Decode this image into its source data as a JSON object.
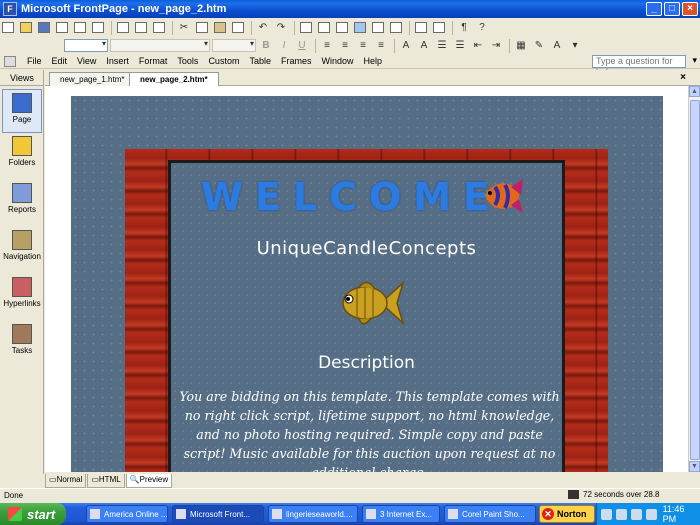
{
  "window": {
    "title": "Microsoft FrontPage - new_page_2.htm",
    "controls": {
      "minimize": "_",
      "maximize": "□",
      "close": "×"
    }
  },
  "menubar": {
    "items": [
      "File",
      "Edit",
      "View",
      "Insert",
      "Format",
      "Tools",
      "Custom",
      "Table",
      "Frames",
      "Window",
      "Help"
    ],
    "help_placeholder": "Type a question for help"
  },
  "views_panel": {
    "title": "Views",
    "items": [
      {
        "label": "Page",
        "icon": "page-view-icon",
        "active": true
      },
      {
        "label": "Folders",
        "icon": "folders-view-icon"
      },
      {
        "label": "Reports",
        "icon": "reports-view-icon"
      },
      {
        "label": "Navigation",
        "icon": "navigation-view-icon"
      },
      {
        "label": "Hyperlinks",
        "icon": "hyperlinks-view-icon"
      },
      {
        "label": "Tasks",
        "icon": "tasks-view-icon"
      }
    ]
  },
  "doc_tabs": [
    {
      "label": "new_page_1.htm*",
      "active": false
    },
    {
      "label": "new_page_2.htm*",
      "active": true
    }
  ],
  "page": {
    "welcome": "WELCOME",
    "site_name": "UniqueCandleConcepts",
    "description_heading": "Description",
    "description_body": "You are bidding on this template. This template comes with no right click script, lifetime support, no html knowledge, and no photo hosting required. Simple copy and paste script! Music available for this auction upon request at no additional charge."
  },
  "view_modes": [
    {
      "label": "Normal",
      "active": false
    },
    {
      "label": "HTML",
      "active": false
    },
    {
      "label": "Preview",
      "active": true
    }
  ],
  "status": {
    "left": "Done",
    "right": "72 seconds over 28.8"
  },
  "taskbar": {
    "start": "start",
    "tasks": [
      {
        "label": "America Online ..."
      },
      {
        "label": "Microsoft Front...",
        "active": true
      },
      {
        "label": "lingerieseaworld...."
      },
      {
        "label": "3 Internet Ex..."
      },
      {
        "label": "Corel Paint Sho..."
      }
    ],
    "norton": "Norton",
    "clock": "11:46 PM"
  }
}
